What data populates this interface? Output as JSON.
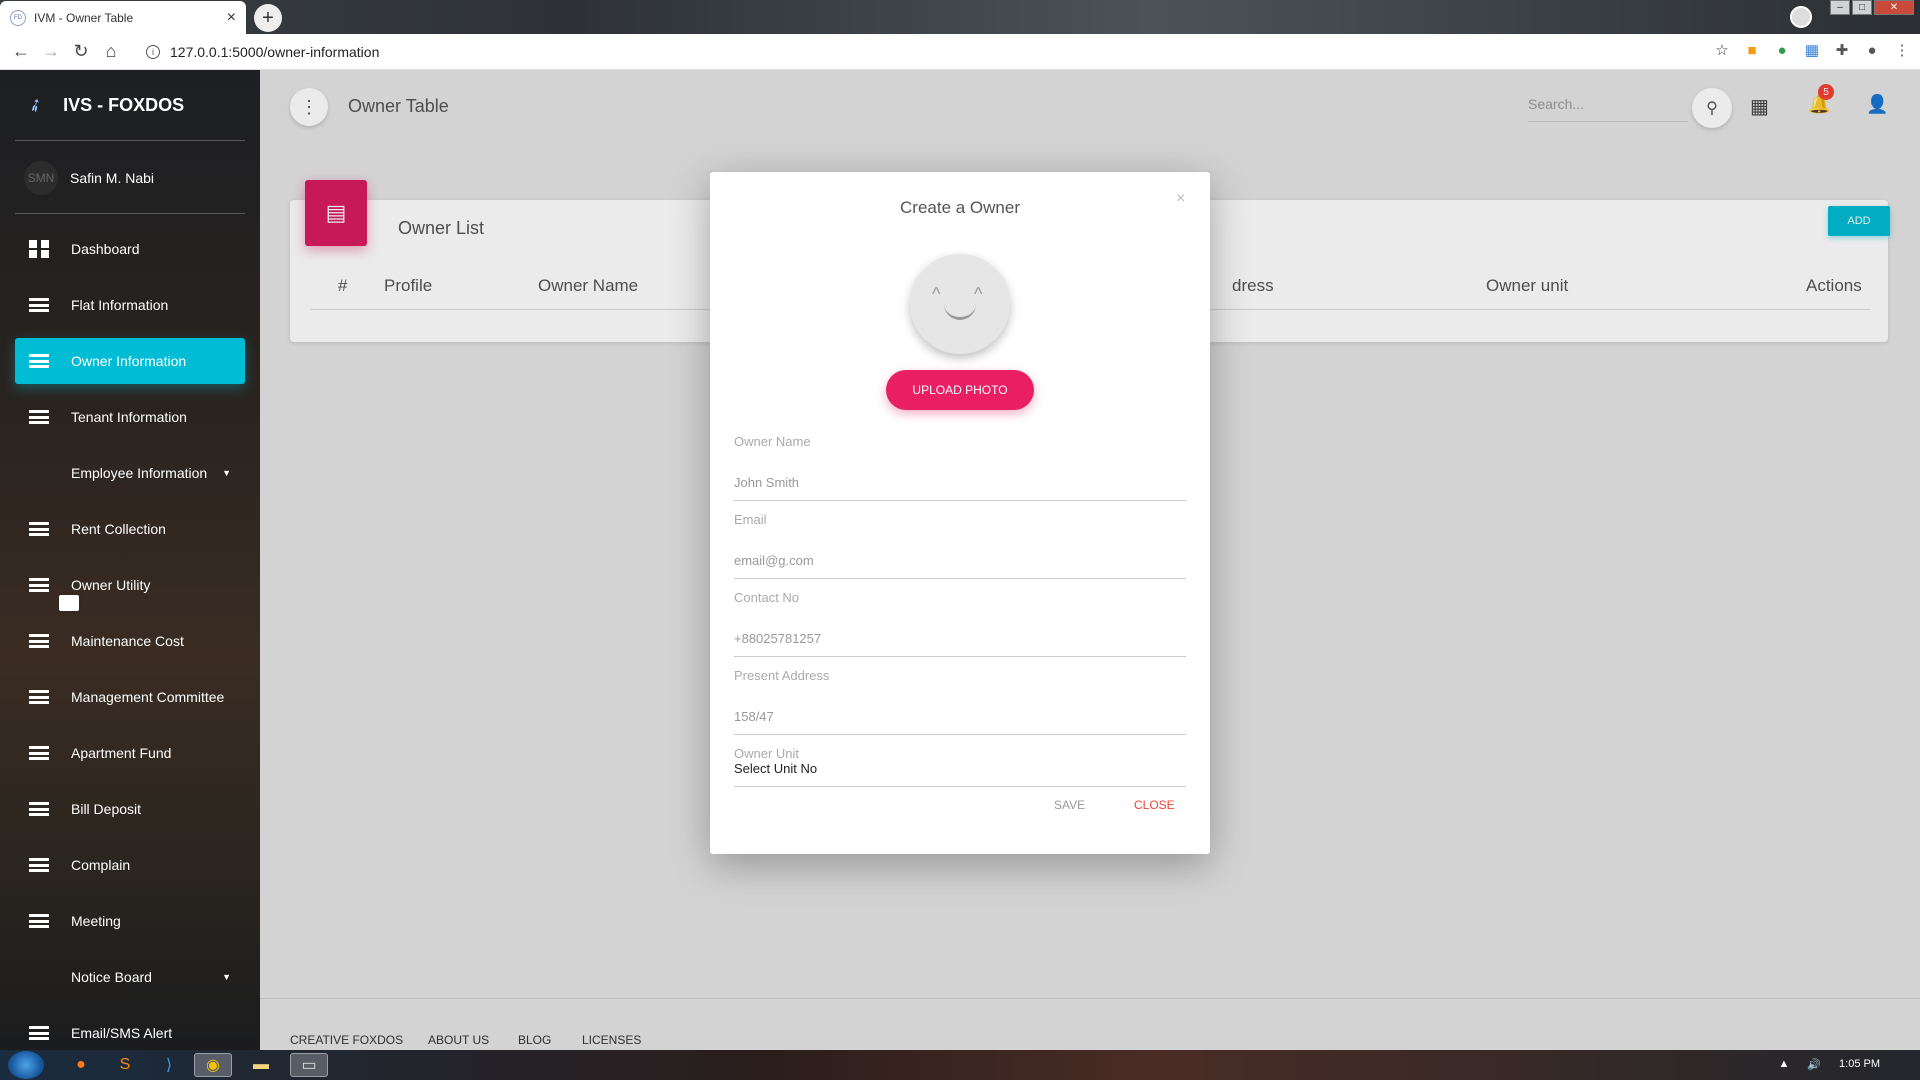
{
  "browser": {
    "tab_title": "IVM - Owner Table",
    "favicon": "FD",
    "url": "127.0.0.1:5000/owner-information"
  },
  "sidebar": {
    "brand": "IVS - FOXDOS",
    "user_initials": "SMN",
    "user_name": "Safin M. Nabi",
    "items": [
      {
        "label": "Dashboard",
        "icon": "dashboard-icon"
      },
      {
        "label": "Flat Information",
        "icon": "list-icon"
      },
      {
        "label": "Owner Information",
        "icon": "list-icon",
        "active": true
      },
      {
        "label": "Tenant Information",
        "icon": "list-icon"
      },
      {
        "label": "Employee Information",
        "icon": "card-icon",
        "caret": true
      },
      {
        "label": "Rent Collection",
        "icon": "list-icon"
      },
      {
        "label": "Owner Utility",
        "icon": "list-icon"
      },
      {
        "label": "Maintenance Cost",
        "icon": "list-icon"
      },
      {
        "label": "Management Committee",
        "icon": "list-icon"
      },
      {
        "label": "Apartment Fund",
        "icon": "list-icon"
      },
      {
        "label": "Bill Deposit",
        "icon": "list-icon"
      },
      {
        "label": "Complain",
        "icon": "list-icon"
      },
      {
        "label": "Meeting",
        "icon": "list-icon"
      },
      {
        "label": "Notice Board",
        "icon": "card-icon",
        "caret": true
      },
      {
        "label": "Email/SMS Alert",
        "icon": "list-icon"
      }
    ]
  },
  "topbar": {
    "title": "Owner Table",
    "search_placeholder": "Search...",
    "notification_count": "5"
  },
  "card": {
    "title": "Owner List",
    "add_label": "ADD",
    "columns": [
      "#",
      "Profile",
      "Owner Name",
      "dress",
      "Owner unit",
      "Actions"
    ]
  },
  "modal": {
    "title": "Create a Owner",
    "upload_label": "UPLOAD PHOTO",
    "fields": [
      {
        "label": "Owner Name",
        "placeholder": "John Smith"
      },
      {
        "label": "Email",
        "placeholder": "email@g.com"
      },
      {
        "label": "Contact No",
        "placeholder": "+88025781257"
      },
      {
        "label": "Present Address",
        "placeholder": "158/47"
      }
    ],
    "unit_label": "Owner Unit",
    "unit_value": "Select Unit No",
    "save_label": "SAVE",
    "close_label": "CLOSE"
  },
  "footer": {
    "links": [
      "CREATIVE FOXDOS",
      "ABOUT US",
      "BLOG",
      "LICENSES"
    ]
  },
  "taskbar": {
    "time": "1:05 PM"
  },
  "colors": {
    "accent": "#00bcd4",
    "pink": "#e91e63",
    "card_icon": "#d81b60",
    "danger": "#f44336"
  }
}
